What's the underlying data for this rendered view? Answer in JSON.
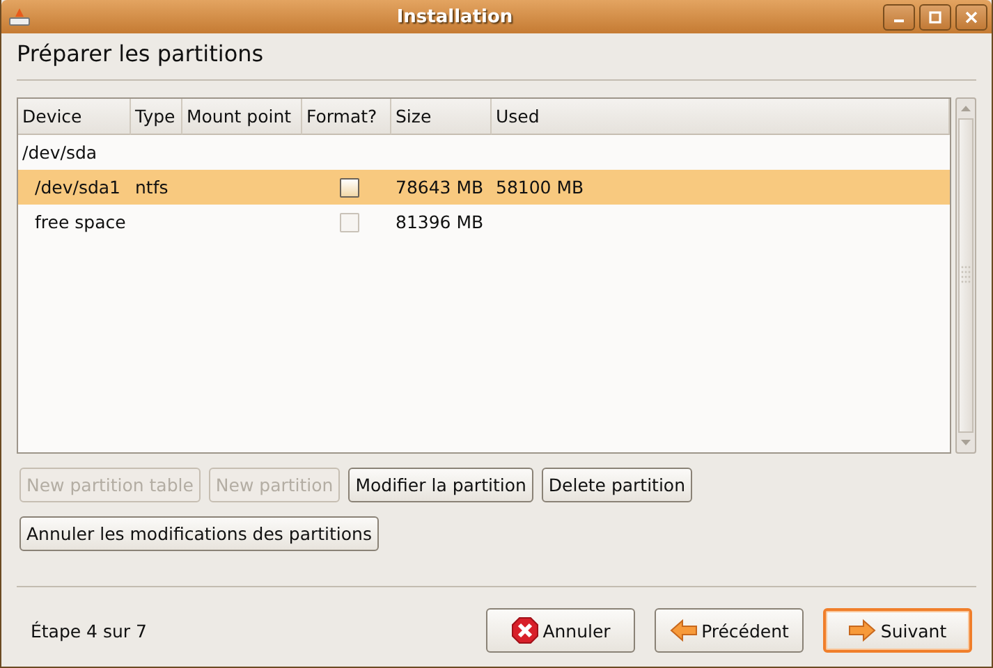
{
  "window": {
    "title": "Installation"
  },
  "heading": "Préparer les partitions",
  "table": {
    "columns": [
      "Device",
      "Type",
      "Mount point",
      "Format?",
      "Size",
      "Used"
    ],
    "rows": [
      {
        "kind": "disk",
        "device": "/dev/sda",
        "selected": false
      },
      {
        "kind": "partition",
        "device": "/dev/sda1",
        "type": "ntfs",
        "format": false,
        "disabled": false,
        "size": "78643 MB",
        "used": "58100 MB",
        "selected": true
      },
      {
        "kind": "partition",
        "device": "free space",
        "format": false,
        "disabled": true,
        "size": "81396 MB",
        "selected": false
      }
    ]
  },
  "actions": [
    {
      "label": "New partition table",
      "disabled": true
    },
    {
      "label": "New partition",
      "disabled": true
    },
    {
      "label": "Modifier la partition",
      "disabled": false
    },
    {
      "label": "Delete partition",
      "disabled": false
    },
    {
      "label": "Annuler les modifications des partitions",
      "disabled": false
    }
  ],
  "step": "Étape 4 sur 7",
  "nav": [
    {
      "kind": "cancel",
      "label": "Annuler",
      "default": false
    },
    {
      "kind": "back",
      "label": "Précédent",
      "default": false
    },
    {
      "kind": "forward",
      "label": "Suivant",
      "default": true
    }
  ]
}
